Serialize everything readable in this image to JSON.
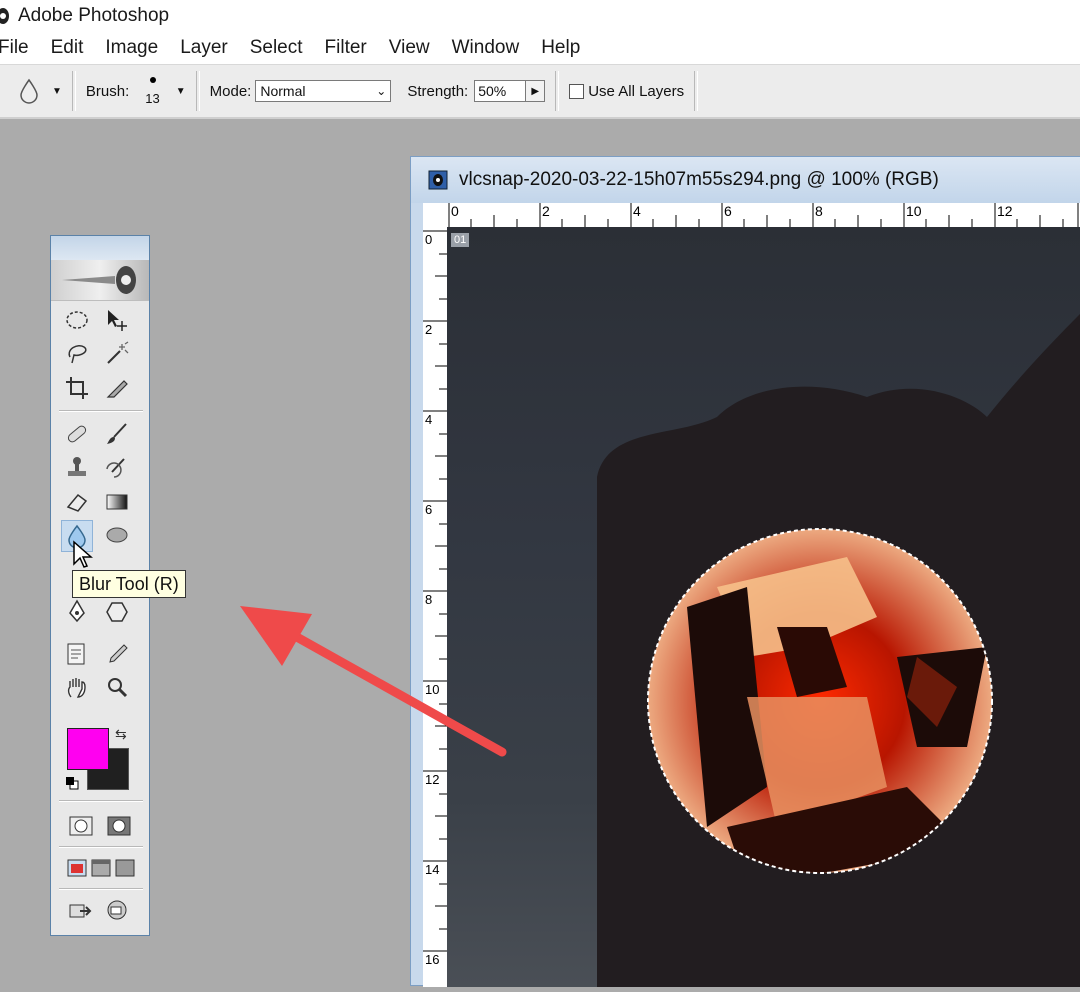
{
  "app": {
    "title": "Adobe Photoshop"
  },
  "menu": [
    "File",
    "Edit",
    "Image",
    "Layer",
    "Select",
    "Filter",
    "View",
    "Window",
    "Help"
  ],
  "options": {
    "brush_label": "Brush:",
    "brush_size": "13",
    "mode_label": "Mode:",
    "mode_value": "Normal",
    "strength_label": "Strength:",
    "strength_value": "50%",
    "use_all_layers_label": "Use All Layers",
    "use_all_layers_checked": false
  },
  "toolbox": {
    "tooltip": "Blur Tool (R)",
    "foreground_color": "#ff00f0",
    "background_color": "#202020",
    "active_tool": "blur-tool"
  },
  "document": {
    "title": "vlcsnap-2020-03-22-15h07m55s294.png @ 100% (RGB)",
    "layer_badge": "01",
    "ruler_top_labels": [
      "0",
      "2",
      "4",
      "6",
      "8",
      "10",
      "12"
    ],
    "ruler_left_labels": [
      "0",
      "2",
      "4",
      "6",
      "8",
      "10",
      "12",
      "14",
      "16"
    ]
  },
  "colors": {
    "annotation_arrow": "#ef4a4a",
    "canvas_dark": "#221d20"
  }
}
